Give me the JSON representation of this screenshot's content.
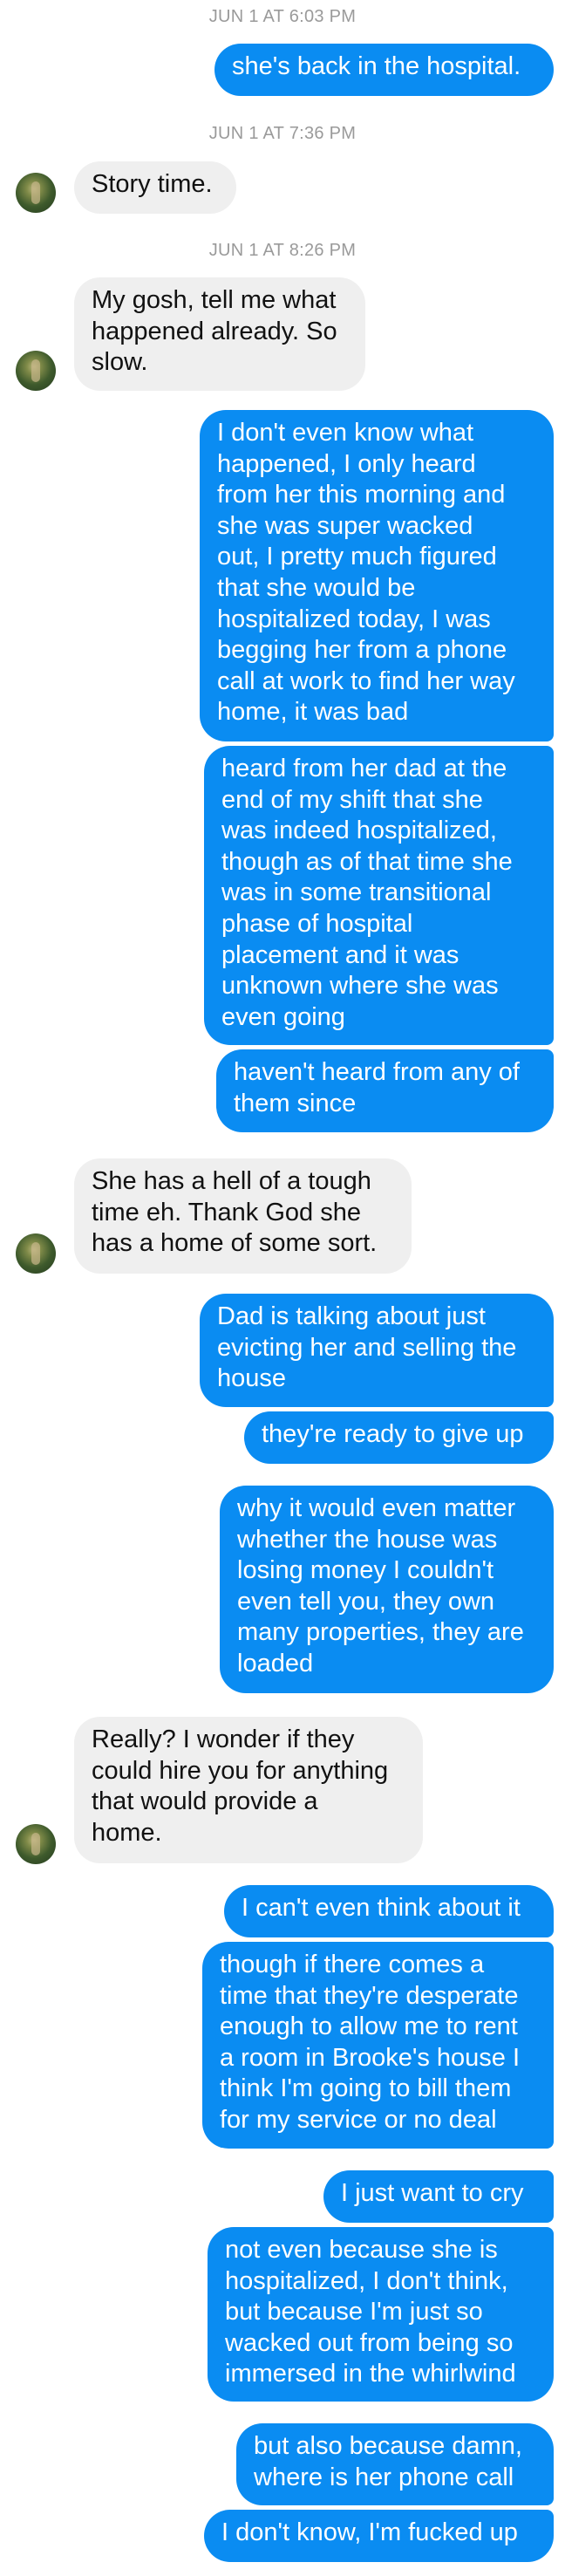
{
  "timestamps": [
    "JUN 1 AT 6:03 PM",
    "JUN 1 AT 7:36 PM",
    "JUN 1 AT 8:26 PM"
  ],
  "messages": [
    {
      "dir": "out",
      "lines": [
        "she's back in the hospital."
      ]
    },
    {
      "dir": "in",
      "lines": [
        "Story time."
      ]
    },
    {
      "dir": "in",
      "lines": [
        "My gosh, tell me what",
        "happened already. So",
        "slow."
      ]
    },
    {
      "dir": "out",
      "lines": [
        "I don't even know what",
        "happened, I only heard",
        "from her this morning and",
        "she was super wacked",
        "out, I pretty much figured",
        "that she would be",
        "hospitalized today, I was",
        "begging her from a phone",
        "call at work to find her way",
        "home, it was bad"
      ]
    },
    {
      "dir": "out",
      "lines": [
        "heard from her dad at the",
        "end of my shift that she",
        "was indeed hospitalized,",
        "though as of that time she",
        "was in some transitional",
        "phase of hospital",
        "placement and it was",
        "unknown where she was",
        "even going"
      ]
    },
    {
      "dir": "out",
      "lines": [
        "haven't heard from any of",
        "them since"
      ]
    },
    {
      "dir": "in",
      "lines": [
        "She has a hell of a tough",
        "time eh. Thank God she",
        "has a home of some sort."
      ]
    },
    {
      "dir": "out",
      "lines": [
        "Dad is talking about just",
        "evicting her and selling the",
        "house"
      ]
    },
    {
      "dir": "out",
      "lines": [
        "they're ready to give up"
      ]
    },
    {
      "dir": "out",
      "lines": [
        "why it would even matter",
        "whether the house was",
        "losing money I couldn't",
        "even tell you, they own",
        "many properties, they are",
        "loaded"
      ]
    },
    {
      "dir": "in",
      "lines": [
        "Really? I wonder if they",
        "could hire you for anything",
        "that would provide a",
        "home."
      ]
    },
    {
      "dir": "out",
      "lines": [
        "I can't even think about it"
      ]
    },
    {
      "dir": "out",
      "lines": [
        "though if there comes a",
        "time that they're desperate",
        "enough to allow me to rent",
        "a room in Brooke's house I",
        "think I'm going to bill them",
        "for my service or no deal"
      ]
    },
    {
      "dir": "out",
      "lines": [
        "I just want to cry"
      ]
    },
    {
      "dir": "out",
      "lines": [
        "not even because she is",
        "hospitalized, I don't think,",
        "but because I'm just so",
        "wacked out from being so",
        "immersed in the whirlwind"
      ]
    },
    {
      "dir": "out",
      "lines": [
        "but also because damn,",
        "where is her phone call"
      ]
    },
    {
      "dir": "out",
      "lines": [
        "I don't know, I'm fucked up"
      ]
    }
  ]
}
